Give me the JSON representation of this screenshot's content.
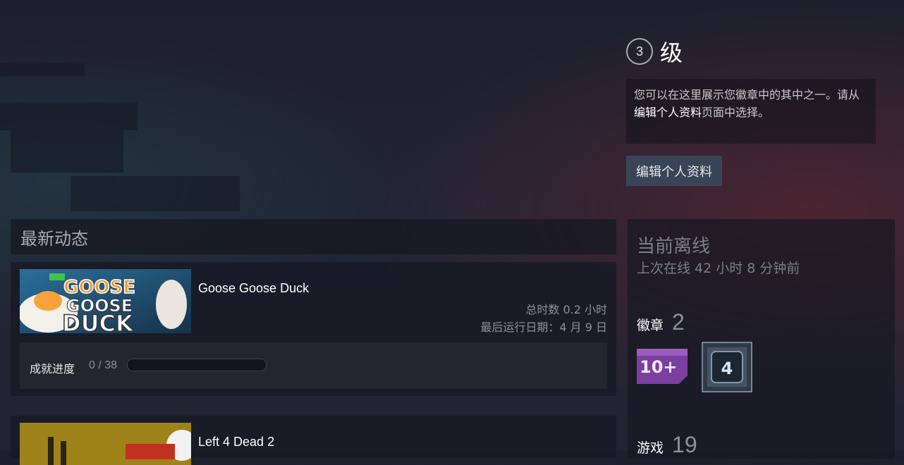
{
  "profile": {
    "level": "3",
    "level_suffix": "级",
    "badge_note_part1": "您可以在这里展示您徽章中的其中之一。请从",
    "badge_note_link": "编辑个人资料",
    "badge_note_part2": "页面中选择。",
    "edit_button": "编辑个人资料"
  },
  "recent": {
    "header": "最新动态",
    "games": [
      {
        "name": "Goose Goose Duck",
        "total_time": "总时数 0.2 小时",
        "last_played": "最后运行日期：4 月 9 日",
        "achievements_label": "成就进度",
        "achievements_count": "0 / 38",
        "achievement_progress": 0
      },
      {
        "name": "Left 4 Dead 2"
      }
    ]
  },
  "status": {
    "title": "当前离线",
    "last_online": "上次在线 42 小时 8 分钟前"
  },
  "badges": {
    "label": "徽章",
    "count": "2",
    "items": [
      "10+",
      "4"
    ]
  },
  "games": {
    "label": "游戏",
    "count": "19"
  }
}
